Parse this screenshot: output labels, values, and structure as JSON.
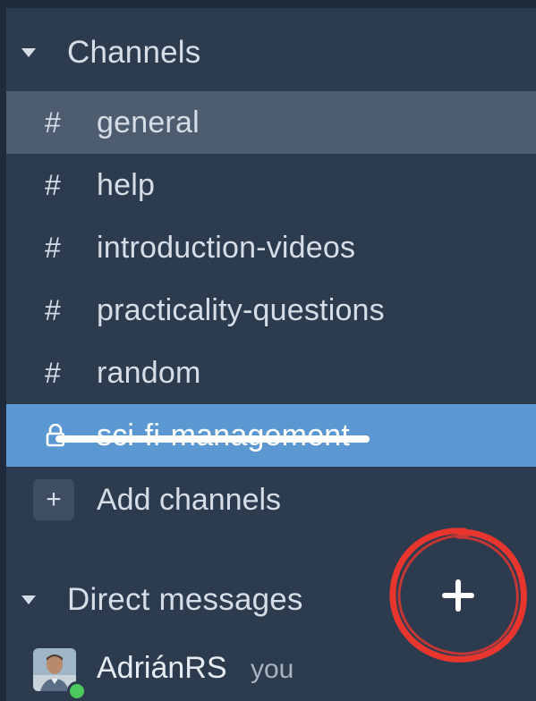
{
  "sidebar": {
    "channels_header": {
      "title": "Channels",
      "icon": "caret-down-icon"
    },
    "channels": [
      {
        "prefix": "#",
        "name": "general",
        "state": "active"
      },
      {
        "prefix": "#",
        "name": "help",
        "state": "normal"
      },
      {
        "prefix": "#",
        "name": "introduction-videos",
        "state": "normal"
      },
      {
        "prefix": "#",
        "name": "practicality-questions",
        "state": "normal"
      },
      {
        "prefix": "#",
        "name": "random",
        "state": "normal"
      },
      {
        "prefix": "lock-icon",
        "name": "sci-fi-management",
        "state": "selected",
        "struck_through": true
      }
    ],
    "add_channels": {
      "icon": "+",
      "label": "Add channels"
    },
    "dm_header": {
      "title": "Direct messages",
      "icon": "caret-down-icon"
    },
    "add_dm_button": {
      "icon": "plus-icon",
      "highlight": "red-circle-annotation"
    },
    "direct_messages": [
      {
        "name": "AdriánRS",
        "suffix": "you",
        "presence": "online"
      }
    ]
  },
  "colors": {
    "sidebar_bg": "#2d3b4f",
    "active_bg": "#4d5c6e",
    "selected_bg": "#5b98d2",
    "text": "#d7dde6",
    "annotation_red": "#e8362f",
    "presence_green": "#4cc95d"
  }
}
